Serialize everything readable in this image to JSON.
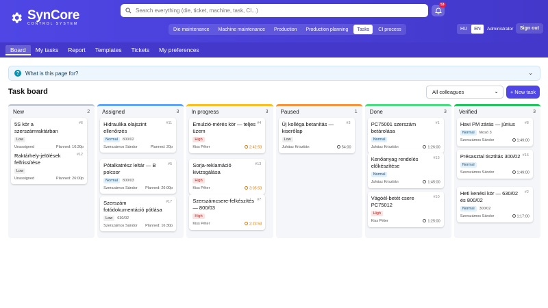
{
  "app": {
    "name": "SynCore",
    "subtitle": "CONTROL SYSTEM"
  },
  "search": {
    "placeholder": "Search everything (die, ticket, machine, task, CI...)"
  },
  "notifications": {
    "count": "53"
  },
  "modules": [
    {
      "label": "Die maintenance",
      "active": false
    },
    {
      "label": "Machine maintenance",
      "active": false
    },
    {
      "label": "Production",
      "active": false
    },
    {
      "label": "Production planning",
      "active": false
    },
    {
      "label": "Tasks",
      "active": true
    },
    {
      "label": "CI process",
      "active": false
    }
  ],
  "lang": {
    "hu": "HU",
    "en": "EN",
    "active": "EN"
  },
  "user": {
    "name": "Administrator",
    "signout": "Sign out"
  },
  "subnav": [
    {
      "label": "Board",
      "active": true
    },
    {
      "label": "My tasks",
      "active": false
    },
    {
      "label": "Report",
      "active": false
    },
    {
      "label": "Templates",
      "active": false
    },
    {
      "label": "Tickets",
      "active": false
    },
    {
      "label": "My preferences",
      "active": false
    }
  ],
  "help": {
    "text": "What is this page for?"
  },
  "page": {
    "title": "Task board",
    "filter": "All colleagues",
    "new_task": "+ New task"
  },
  "colors": {
    "accent": "#4f46e5",
    "new": "#c5ccd6",
    "assigned": "#60a5fa",
    "inprogress": "#fbbf24",
    "paused": "#fb923c",
    "done": "#4ade80",
    "verified": "#22c55e"
  },
  "columns": [
    {
      "name": "New",
      "count": "2",
      "color": "#c5ccd6",
      "cards": [
        {
          "title": "5S kör a szerszámraktárban",
          "id": "#6",
          "priority": "Low",
          "code": "",
          "assignee": "Unassigned",
          "meta": "Planned: 16:30p",
          "warn": false
        },
        {
          "title": "Raktárhely-jelölések felfrissítése",
          "id": "#12",
          "priority": "Low",
          "code": "",
          "assignee": "Unassigned",
          "meta": "Planned: 26:00p",
          "warn": false
        }
      ]
    },
    {
      "name": "Assigned",
      "count": "3",
      "color": "#60a5fa",
      "cards": [
        {
          "title": "Hidraulika olajszint ellenőrzés",
          "id": "#11",
          "priority": "Normal",
          "code": "800/02",
          "assignee": "Szerszámos Sándor",
          "meta": "Planned: 20p",
          "warn": false
        },
        {
          "title": "Pótalkatrész leltár — B polcsor",
          "id": "#5",
          "priority": "Normal",
          "code": "800/03",
          "assignee": "Szerszámos Sándor",
          "meta": "Planned: 26:00p",
          "warn": false
        },
        {
          "title": "Szerszám fotódokumentáció pótlása",
          "id": "#17",
          "priority": "Low",
          "code": "630/02",
          "assignee": "Szerszámos Sándor",
          "meta": "Planned: 16:30p",
          "warn": false
        }
      ]
    },
    {
      "name": "In progress",
      "count": "3",
      "color": "#fbbf24",
      "cards": [
        {
          "title": "Emulzió-mérés kör — teljes üzem",
          "id": "#4",
          "priority": "High",
          "code": "",
          "assignee": "Kiss Péter",
          "meta": "2:42:53",
          "warn": true
        },
        {
          "title": "Sorja-reklamáció kivizsgálása",
          "id": "#13",
          "priority": "High",
          "code": "",
          "assignee": "Kiss Péter",
          "meta": "3:05:53",
          "warn": true
        },
        {
          "title": "Szerszámcsere-felkészítés — 800/03",
          "id": "#7",
          "priority": "High",
          "code": "",
          "assignee": "Kiss Péter",
          "meta": "2:23:53",
          "warn": true
        }
      ]
    },
    {
      "name": "Paused",
      "count": "1",
      "color": "#fb923c",
      "cards": [
        {
          "title": "Új kolléga betanítás — kiserőlap",
          "id": "#3",
          "priority": "Low",
          "code": "",
          "assignee": "Juhász Krisztián",
          "meta": "54:00",
          "warn": false
        }
      ]
    },
    {
      "name": "Done",
      "count": "3",
      "color": "#4ade80",
      "cards": [
        {
          "title": "PC75001 szerszám betárolása",
          "id": "#1",
          "priority": "Normal",
          "code": "",
          "assignee": "Juhász Krisztián",
          "meta": "1:26:00",
          "warn": false
        },
        {
          "title": "Kenőanyag rendelés előkészítése",
          "id": "#15",
          "priority": "Normal",
          "code": "",
          "assignee": "Juhász Krisztián",
          "meta": "1:45:00",
          "warn": false
        },
        {
          "title": "Vágóél-betét csere PC75012",
          "id": "#10",
          "priority": "High",
          "code": "",
          "assignee": "Kiss Péter",
          "meta": "1:25:00",
          "warn": false
        }
      ]
    },
    {
      "name": "Verified",
      "count": "3",
      "color": "#22c55e",
      "cards": [
        {
          "title": "Havi PM zárás — június",
          "id": "#8",
          "priority": "Normal",
          "code": "Mosó 3",
          "assignee": "Szerszámos Sándor",
          "meta": "1:49:00",
          "warn": false
        },
        {
          "title": "Présasztal tisztítás 300/02",
          "id": "#16",
          "priority": "Normal",
          "code": "",
          "assignee": "Szerszámos Sándor",
          "meta": "1:49:00",
          "warn": false
        },
        {
          "title": "Heti kenési kör — 630/02 és 800/02",
          "id": "#2",
          "priority": "Normal",
          "code": "300/02",
          "assignee": "Szerszámos Sándor",
          "meta": "1:17:00",
          "warn": false
        }
      ]
    }
  ]
}
